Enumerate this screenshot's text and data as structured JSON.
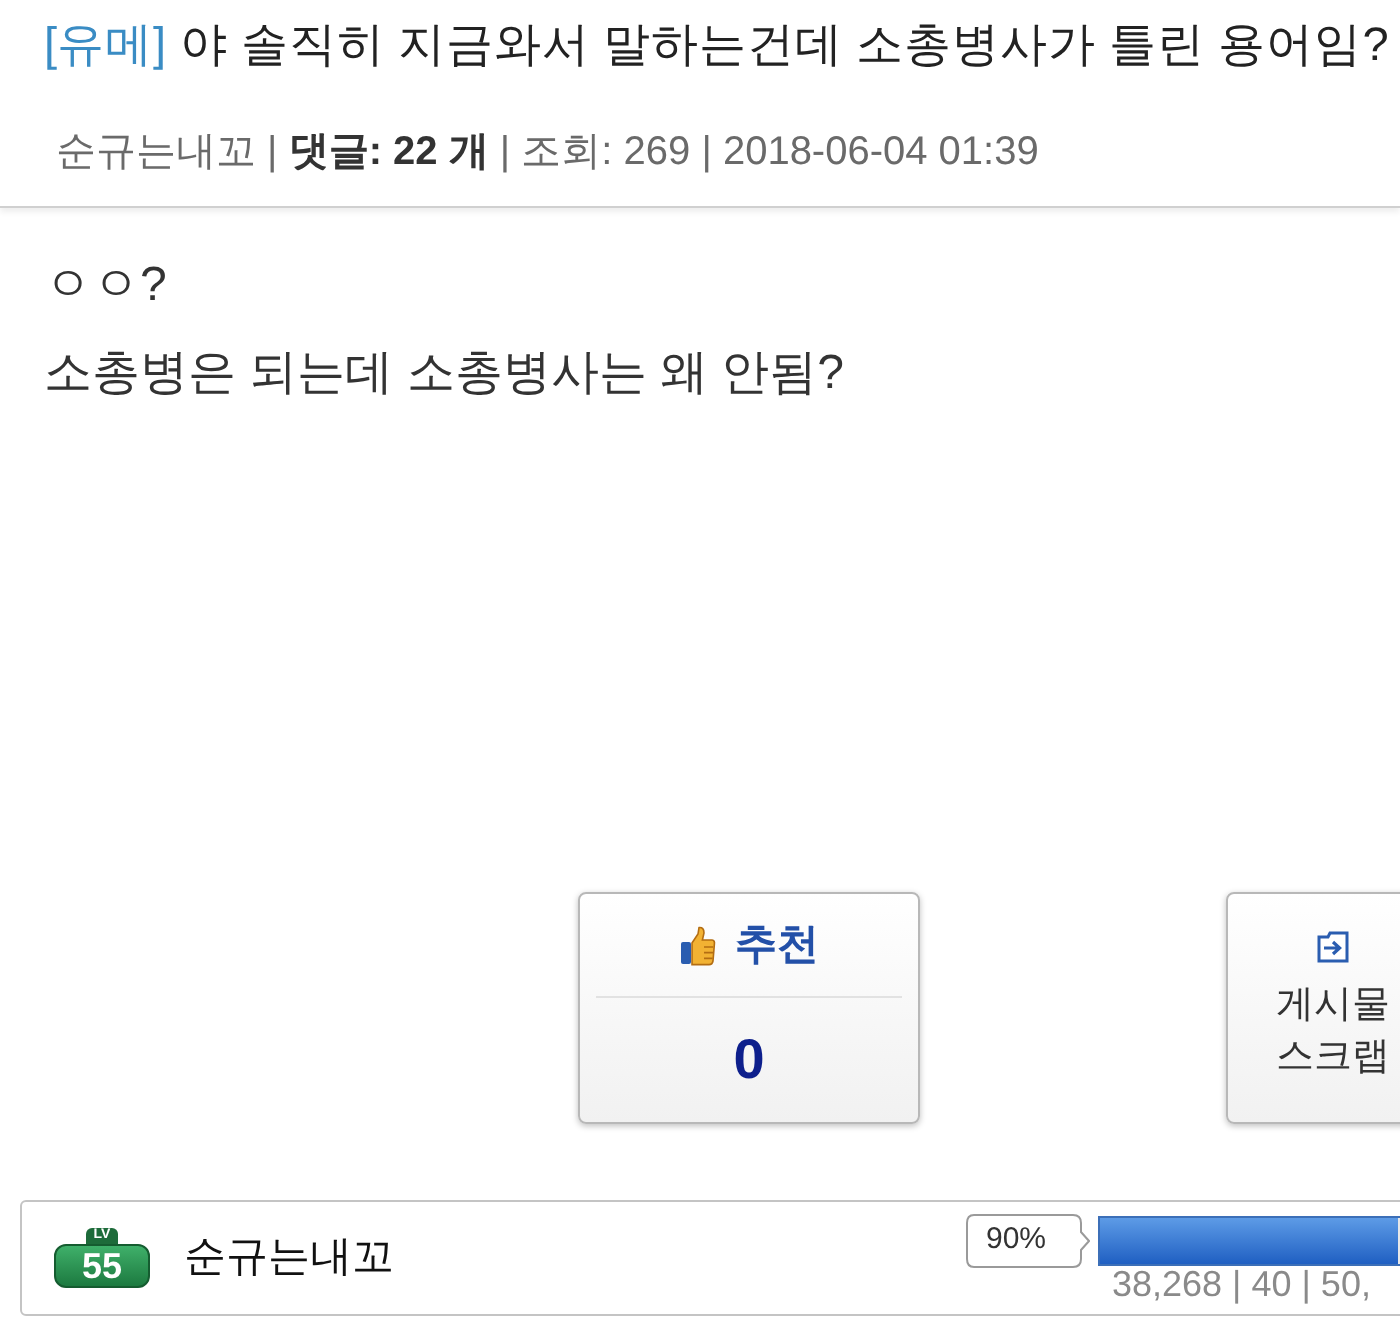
{
  "post": {
    "category": "[유메]",
    "title": "야 솔직히 지금와서 말하는건데 소총병사가 틀린 용어임?",
    "meta": "순규는내꼬 | **댓글: 22 개** | 조회: 269 | 2018-06-04 01:39"
  },
  "body": [
    "ㅇㅇ?",
    "소총병은 되는데 소총병사는 왜 안됨?"
  ],
  "actions": [
    {
      "kind": "recommend",
      "label": "추천",
      "count": "0"
    },
    {
      "kind": "scrap",
      "lines": [
        "게시물",
        "스크랩"
      ]
    }
  ],
  "author_bar": {
    "badge": {
      "caption": "LV",
      "number": "55"
    },
    "name": "순규는내꼬",
    "progress": {
      "tooltip": "90%",
      "level": 0.9,
      "stats": "38,268 | 40 | 50,"
    }
  }
}
